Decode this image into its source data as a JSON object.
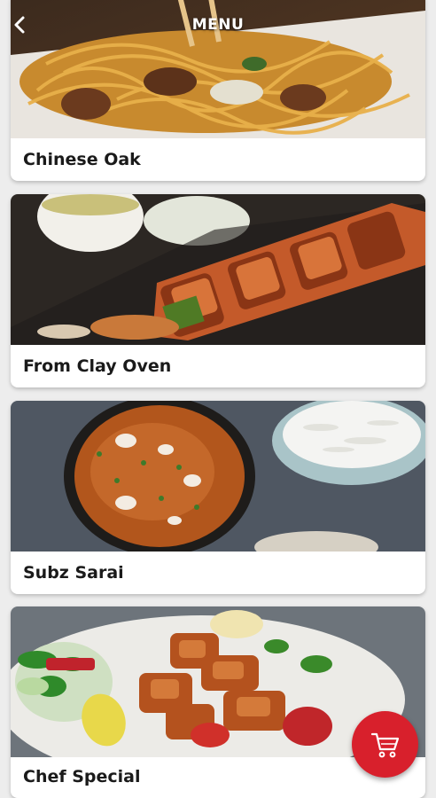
{
  "header": {
    "title": "MENU",
    "back_icon": "chevron-left-icon"
  },
  "categories": [
    {
      "label": "Chinese Oak"
    },
    {
      "label": "From Clay Oven"
    },
    {
      "label": "Subz Sarai"
    },
    {
      "label": "Chef Special"
    }
  ],
  "cart": {
    "icon": "shopping-cart-icon",
    "color": "#d8202c"
  }
}
